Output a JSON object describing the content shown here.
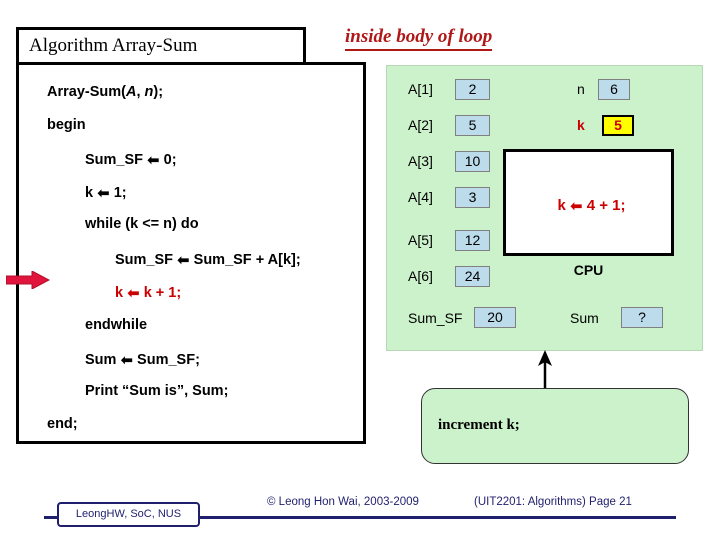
{
  "algorithm": {
    "title": "Algorithm Array-Sum",
    "lines": [
      {
        "text": "Array-Sum(A, n);",
        "indent": 0,
        "color": "black",
        "italic_parts": "A, n"
      },
      {
        "text": "begin",
        "indent": 0,
        "color": "black"
      },
      {
        "text": "Sum_SF ← 0;",
        "indent": 1,
        "color": "black"
      },
      {
        "text": "k ← 1;",
        "indent": 1,
        "color": "black"
      },
      {
        "text": "while (k <= n) do",
        "indent": 1,
        "color": "black"
      },
      {
        "text": "Sum_SF ← Sum_SF + A[k];",
        "indent": 2,
        "color": "black"
      },
      {
        "text": "k ← k + 1;",
        "indent": 2,
        "color": "red"
      },
      {
        "text": "endwhile",
        "indent": 1,
        "color": "black"
      },
      {
        "text": "Sum ← Sum_SF;",
        "indent": 1,
        "color": "black"
      },
      {
        "text": "Print “Sum is”, Sum;",
        "indent": 1,
        "color": "black"
      },
      {
        "text": "end;",
        "indent": 0,
        "color": "black"
      }
    ]
  },
  "caption": {
    "loop_marker": "inside body of loop"
  },
  "memory": {
    "array": [
      {
        "label": "A[1]",
        "value": "2"
      },
      {
        "label": "A[2]",
        "value": "5"
      },
      {
        "label": "A[3]",
        "value": "10"
      },
      {
        "label": "A[4]",
        "value": "3"
      },
      {
        "label": "A[5]",
        "value": "12"
      },
      {
        "label": "A[6]",
        "value": "24"
      }
    ],
    "variables": [
      {
        "label": "n",
        "value": "6",
        "highlight": false
      },
      {
        "label": "k",
        "value": "5",
        "highlight": true
      }
    ],
    "accumulator": {
      "label": "Sum_SF",
      "value": "20"
    },
    "result": {
      "label": "Sum",
      "value": "?"
    }
  },
  "cpu": {
    "expression": "k ← 4 + 1;",
    "label": "CPU"
  },
  "annotation": {
    "increment_note": "increment k;"
  },
  "footer": {
    "logo": "LeongHW, SoC, NUS",
    "copyright": "© Leong Hon Wai, 2003-2009",
    "course": "(UIT2201: Algorithms) Page 21"
  },
  "colors": {
    "panel_green": "#ccf2cc",
    "value_blue": "#bcdcec",
    "highlight_yellow": "#ffff00",
    "accent_red": "#cc0000",
    "caption_red": "#b01818",
    "footer_navy": "#1f1f6e"
  }
}
